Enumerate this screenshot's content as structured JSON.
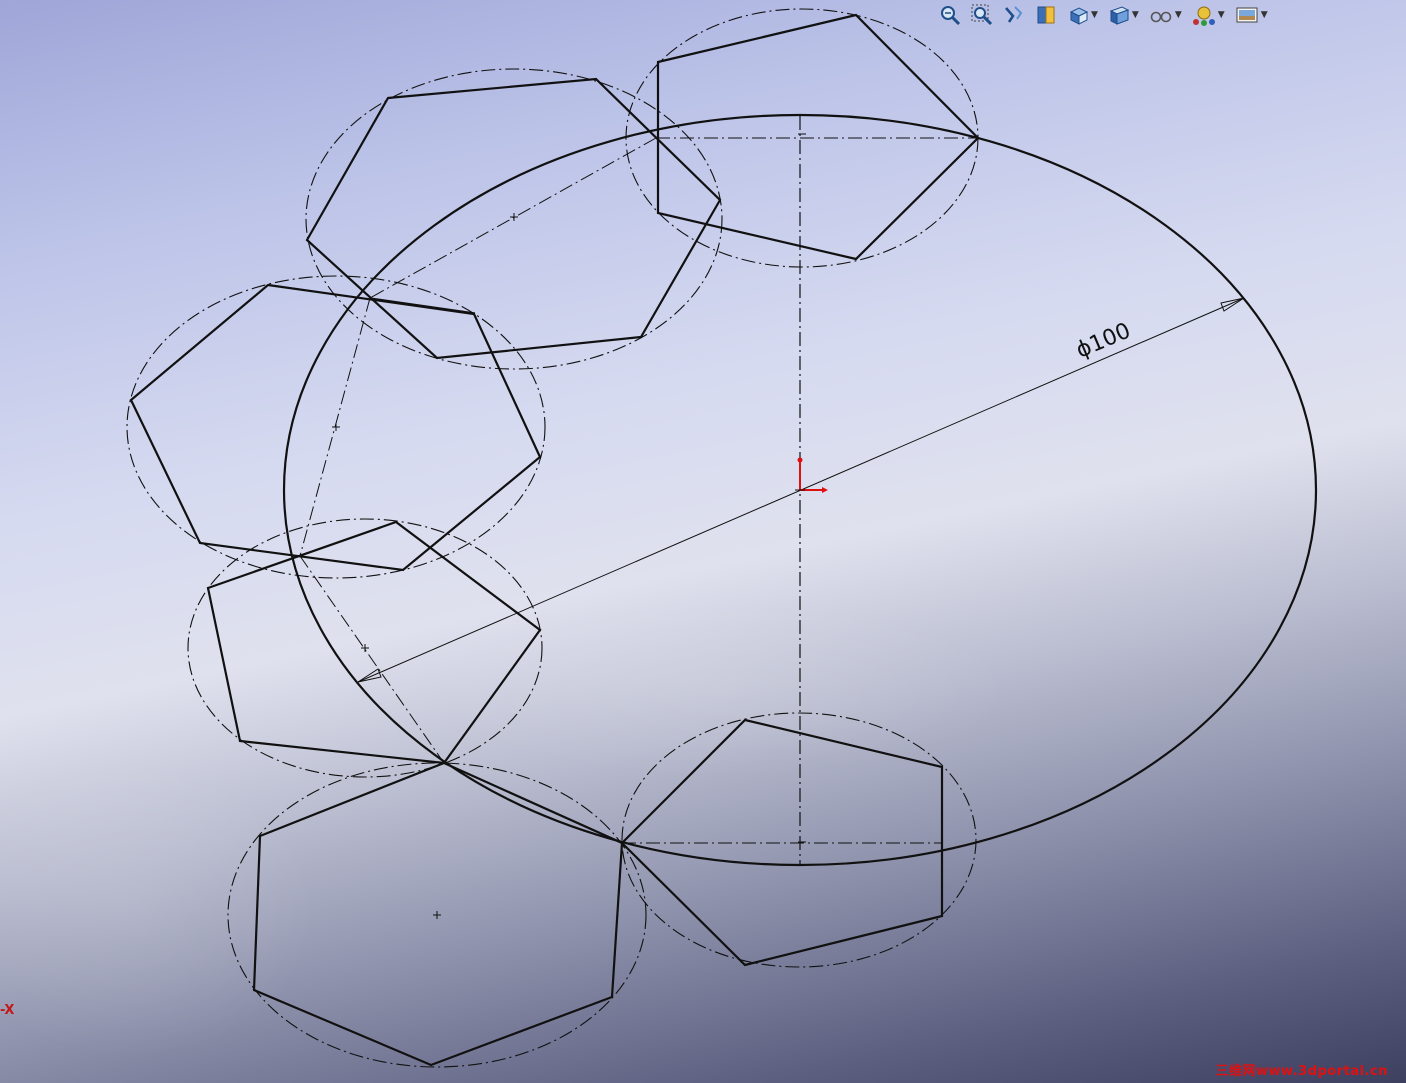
{
  "toolbar": {
    "items": [
      {
        "icon": "zoom-to-fit-icon",
        "dropdown": false
      },
      {
        "icon": "zoom-to-area-icon",
        "dropdown": false
      },
      {
        "icon": "previous-view-icon",
        "dropdown": false
      },
      {
        "icon": "section-view-icon",
        "dropdown": false
      },
      {
        "icon": "view-orientation-icon",
        "dropdown": true
      },
      {
        "icon": "display-style-icon",
        "dropdown": true
      },
      {
        "icon": "hide-show-items-icon",
        "dropdown": true
      },
      {
        "icon": "edit-appearance-icon",
        "dropdown": true
      },
      {
        "icon": "apply-scene-icon",
        "dropdown": true
      }
    ]
  },
  "sketch": {
    "dimension_text": "ϕ100",
    "line_color": "#111111",
    "origin_color": "#e01010"
  },
  "axis_label": "-X",
  "watermark": "三维网www.3dportal.cn"
}
